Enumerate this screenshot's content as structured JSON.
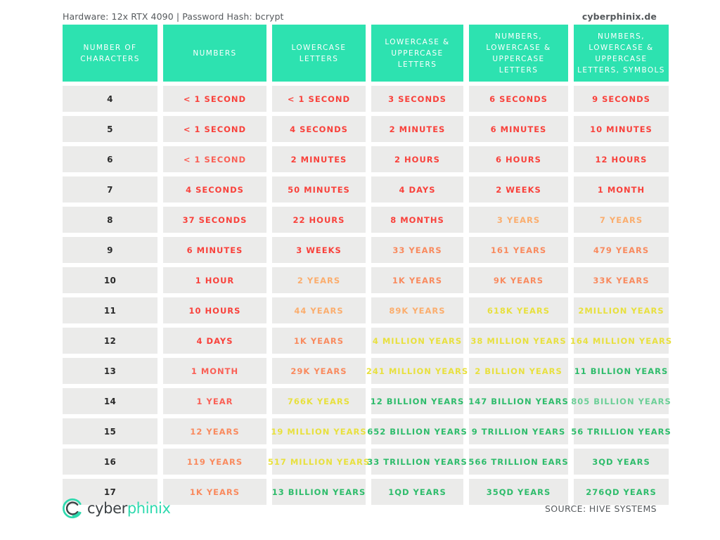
{
  "topbar": {
    "hardware_info": "Hardware: 12x RTX 4090 | Password Hash: bcrypt",
    "site": "cyberphinix.de"
  },
  "colors": {
    "header_bg": "#2de2b0",
    "cell_bg": "#ebebea",
    "page_bg": "#ffffff",
    "red": "#f9413b",
    "red_soft": "#fa5f55",
    "orange": "#f98a5e",
    "orange_light": "#fbad6d",
    "yellow": "#e8e03e",
    "yellow_light": "#ece74f",
    "green": "#2ebc6b",
    "green_light": "#6ccf97",
    "teal": "#2ed9ae",
    "text_dark": "#2b2b2b",
    "text_muted": "#55595c"
  },
  "table": {
    "columns": [
      "NUMBER OF CHARACTERS",
      "NUMBERS",
      "LOWERCASE LETTERS",
      "LOWERCASE & UPPERCASE LETTERS",
      "NUMBERS, LOWERCASE & UPPERCASE LETTERS",
      "NUMBERS, LOWERCASE & UPPERCASE LETTERS, SYMBOLS"
    ],
    "rows": [
      {
        "chars": "4",
        "cells": [
          {
            "text": "< 1 SECOND",
            "color": "#f9413b"
          },
          {
            "text": "< 1 SECOND",
            "color": "#f9413b"
          },
          {
            "text": "3 SECONDS",
            "color": "#f9413b"
          },
          {
            "text": "6 SECONDS",
            "color": "#f9413b"
          },
          {
            "text": "9 SECONDS",
            "color": "#f9413b"
          }
        ]
      },
      {
        "chars": "5",
        "cells": [
          {
            "text": "< 1 SECOND",
            "color": "#f9413b"
          },
          {
            "text": "4 SECONDS",
            "color": "#f9413b"
          },
          {
            "text": "2 MINUTES",
            "color": "#f9413b"
          },
          {
            "text": "6 MINUTES",
            "color": "#f9413b"
          },
          {
            "text": "10 MINUTES",
            "color": "#f9413b"
          }
        ]
      },
      {
        "chars": "6",
        "cells": [
          {
            "text": "< 1 SECOND",
            "color": "#fa5f55"
          },
          {
            "text": "2 MINUTES",
            "color": "#f9413b"
          },
          {
            "text": "2 HOURS",
            "color": "#f9413b"
          },
          {
            "text": "6 HOURS",
            "color": "#f9413b"
          },
          {
            "text": "12 HOURS",
            "color": "#f9413b"
          }
        ]
      },
      {
        "chars": "7",
        "cells": [
          {
            "text": "4 SECONDS",
            "color": "#f9413b"
          },
          {
            "text": "50 MINUTES",
            "color": "#f9413b"
          },
          {
            "text": "4 DAYS",
            "color": "#f9413b"
          },
          {
            "text": "2 WEEKS",
            "color": "#f9413b"
          },
          {
            "text": "1 MONTH",
            "color": "#f9413b"
          }
        ]
      },
      {
        "chars": "8",
        "cells": [
          {
            "text": "37 SECONDS",
            "color": "#f9413b"
          },
          {
            "text": "22 HOURS",
            "color": "#f9413b"
          },
          {
            "text": "8 MONTHS",
            "color": "#f9413b"
          },
          {
            "text": "3 YEARS",
            "color": "#fbad6d"
          },
          {
            "text": "7 YEARS",
            "color": "#fbad6d"
          }
        ]
      },
      {
        "chars": "9",
        "cells": [
          {
            "text": "6 MINUTES",
            "color": "#f9413b"
          },
          {
            "text": "3 WEEKS",
            "color": "#f9413b"
          },
          {
            "text": "33 YEARS",
            "color": "#f98a5e"
          },
          {
            "text": "161 YEARS",
            "color": "#f98a5e"
          },
          {
            "text": "479 YEARS",
            "color": "#f98a5e"
          }
        ]
      },
      {
        "chars": "10",
        "cells": [
          {
            "text": "1 HOUR",
            "color": "#f9413b"
          },
          {
            "text": "2 YEARS",
            "color": "#fbad6d"
          },
          {
            "text": "1K YEARS",
            "color": "#f98a5e"
          },
          {
            "text": "9K YEARS",
            "color": "#f98a5e"
          },
          {
            "text": "33K YEARS",
            "color": "#f98a5e"
          }
        ]
      },
      {
        "chars": "11",
        "cells": [
          {
            "text": "10 HOURS",
            "color": "#f9413b"
          },
          {
            "text": "44 YEARS",
            "color": "#fbad6d"
          },
          {
            "text": "89K YEARS",
            "color": "#fbad6d"
          },
          {
            "text": "618K YEARS",
            "color": "#e8e03e"
          },
          {
            "text": "2MILLION YEARS",
            "color": "#e8e03e"
          }
        ]
      },
      {
        "chars": "12",
        "cells": [
          {
            "text": "4 DAYS",
            "color": "#f9413b"
          },
          {
            "text": "1K YEARS",
            "color": "#f98a5e"
          },
          {
            "text": "4 MILLION YEARS",
            "color": "#e8e03e"
          },
          {
            "text": "38 MILLION YEARS",
            "color": "#e8e03e"
          },
          {
            "text": "164 MILLION YEARS",
            "color": "#e8e03e"
          }
        ]
      },
      {
        "chars": "13",
        "cells": [
          {
            "text": "1 MONTH",
            "color": "#fa5f55"
          },
          {
            "text": "29K YEARS",
            "color": "#f98a5e"
          },
          {
            "text": "241 MILLION YEARS",
            "color": "#e8e03e"
          },
          {
            "text": "2 BILLION YEARS",
            "color": "#e8e03e"
          },
          {
            "text": "11 BILLION YEARS",
            "color": "#2ebc6b"
          }
        ]
      },
      {
        "chars": "14",
        "cells": [
          {
            "text": "1 YEAR",
            "color": "#fa5f55"
          },
          {
            "text": "766K YEARS",
            "color": "#e8e03e"
          },
          {
            "text": "12 BILLION YEARS",
            "color": "#2ebc6b"
          },
          {
            "text": "147 BILLION YEARS",
            "color": "#2ebc6b"
          },
          {
            "text": "805 BILLION YEARS",
            "color": "#6ccf97"
          }
        ]
      },
      {
        "chars": "15",
        "cells": [
          {
            "text": "12 YEARS",
            "color": "#f98a5e"
          },
          {
            "text": "19 MILLION YEARS",
            "color": "#e8e03e"
          },
          {
            "text": "652 BILLION YEARS",
            "color": "#2ebc6b"
          },
          {
            "text": "9 TRILLION YEARS",
            "color": "#2ebc6b"
          },
          {
            "text": "56 TRILLION YEARS",
            "color": "#2ebc6b"
          }
        ]
      },
      {
        "chars": "16",
        "cells": [
          {
            "text": "119 YEARS",
            "color": "#f98a5e"
          },
          {
            "text": "517 MILLION YEARS",
            "color": "#e8e03e"
          },
          {
            "text": "33 TRILLION YEARS",
            "color": "#2ebc6b"
          },
          {
            "text": "566 TRILLION EARS",
            "color": "#2ebc6b"
          },
          {
            "text": "3QD YEARS",
            "color": "#2ebc6b"
          }
        ]
      },
      {
        "chars": "17",
        "cells": [
          {
            "text": "1K YEARS",
            "color": "#f98a5e"
          },
          {
            "text": "13 BILLION YEARS",
            "color": "#2ebc6b"
          },
          {
            "text": "1QD YEARS",
            "color": "#2ebc6b"
          },
          {
            "text": "35QD YEARS",
            "color": "#2ebc6b"
          },
          {
            "text": "276QD YEARS",
            "color": "#2ebc6b"
          }
        ]
      }
    ]
  },
  "footer": {
    "logo_cyber": "cyber",
    "logo_phinix": "phinix",
    "source": "SOURCE: HIVE SYSTEMS"
  }
}
